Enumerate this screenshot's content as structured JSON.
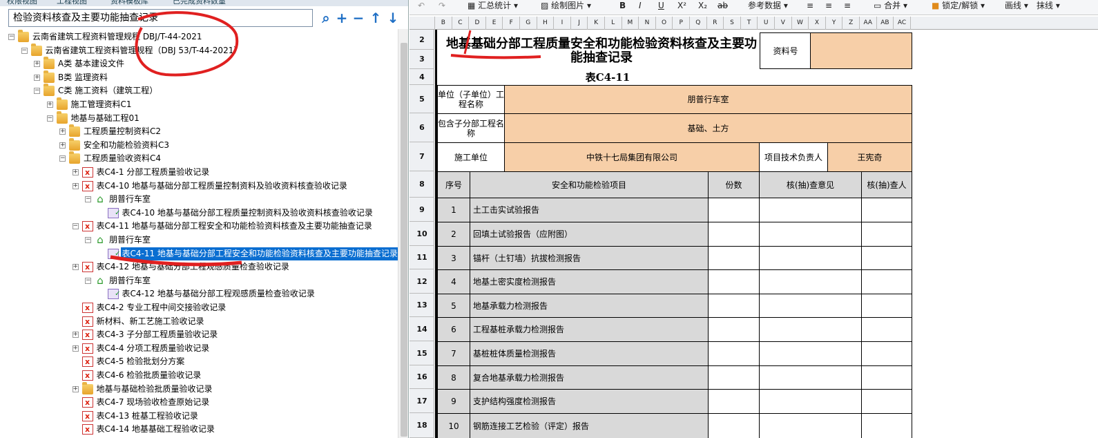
{
  "left_tabs": [
    "权限视图",
    "工程视图",
    "资料模板库",
    "已完成资料数量"
  ],
  "search": {
    "value": "检验资料核查及主要功能抽查记录"
  },
  "toolbar_icons": [
    "search-icon",
    "plus-icon",
    "minus-icon",
    "arrow-up-icon",
    "arrow-down-icon"
  ],
  "tree": [
    {
      "t": "云南省建筑工程资料管理规程 DBJ/T-44-2021",
      "lvl": 0,
      "exp": "-",
      "ico": "folder"
    },
    {
      "t": "云南省建筑工程资料管理规程（DBJ 53/T-44-2021）",
      "lvl": 1,
      "exp": "-",
      "ico": "folder"
    },
    {
      "t": "A类 基本建设文件",
      "lvl": 2,
      "exp": "+",
      "ico": "folder"
    },
    {
      "t": "B类 监理资料",
      "lvl": 2,
      "exp": "+",
      "ico": "folder"
    },
    {
      "t": "C类 施工资料（建筑工程）",
      "lvl": 2,
      "exp": "-",
      "ico": "folder"
    },
    {
      "t": "施工管理资料C1",
      "lvl": 3,
      "exp": "+",
      "ico": "folder"
    },
    {
      "t": "地基与基础工程01",
      "lvl": 3,
      "exp": "-",
      "ico": "folder"
    },
    {
      "t": "工程质量控制资料C2",
      "lvl": 4,
      "exp": "+",
      "ico": "folder"
    },
    {
      "t": "安全和功能检验资料C3",
      "lvl": 4,
      "exp": "+",
      "ico": "folder"
    },
    {
      "t": "工程质量验收资料C4",
      "lvl": 4,
      "exp": "-",
      "ico": "folder"
    },
    {
      "t": "表C4-1 分部工程质量验收记录",
      "lvl": 5,
      "exp": "+",
      "ico": "docx"
    },
    {
      "t": "表C4-10 地基与基础分部工程质量控制资料及验收资料核查验收记录",
      "lvl": 5,
      "exp": "+",
      "ico": "docx"
    },
    {
      "t": "朋普行车室",
      "lvl": 6,
      "exp": "-",
      "ico": "home"
    },
    {
      "t": "表C4-10 地基与基础分部工程质量控制资料及验收资料核查验收记录",
      "lvl": 7,
      "exp": "",
      "ico": "doc2"
    },
    {
      "t": "表C4-11 地基与基础分部工程安全和功能检验资料核查及主要功能抽查记录",
      "lvl": 5,
      "exp": "-",
      "ico": "docx"
    },
    {
      "t": "朋普行车室",
      "lvl": 6,
      "exp": "-",
      "ico": "home"
    },
    {
      "t": "表C4-11 地基与基础分部工程安全和功能检验资料核查及主要功能抽查记录",
      "lvl": 7,
      "exp": "",
      "ico": "doc2",
      "sel": true
    },
    {
      "t": "表C4-12 地基与基础分部工程观感质量检查验收记录",
      "lvl": 5,
      "exp": "+",
      "ico": "docx"
    },
    {
      "t": "朋普行车室",
      "lvl": 6,
      "exp": "-",
      "ico": "home"
    },
    {
      "t": "表C4-12 地基与基础分部工程观感质量检查验收记录",
      "lvl": 7,
      "exp": "",
      "ico": "doc2"
    },
    {
      "t": "表C4-2 专业工程中间交接验收记录",
      "lvl": 5,
      "exp": "",
      "ico": "docx"
    },
    {
      "t": "新材料、新工艺施工验收记录",
      "lvl": 5,
      "exp": "",
      "ico": "docx"
    },
    {
      "t": "表C4-3 子分部工程质量验收记录",
      "lvl": 5,
      "exp": "+",
      "ico": "docx"
    },
    {
      "t": "表C4-4 分项工程质量验收记录",
      "lvl": 5,
      "exp": "+",
      "ico": "docx"
    },
    {
      "t": "表C4-5 检验批划分方案",
      "lvl": 5,
      "exp": "",
      "ico": "docx"
    },
    {
      "t": "表C4-6 检验批质量验收记录",
      "lvl": 5,
      "exp": "",
      "ico": "docx"
    },
    {
      "t": "地基与基础检验批质量验收记录",
      "lvl": 5,
      "exp": "+",
      "ico": "folder"
    },
    {
      "t": "表C4-7 现场验收检查原始记录",
      "lvl": 5,
      "exp": "",
      "ico": "docx"
    },
    {
      "t": "表C4-13 桩基工程验收记录",
      "lvl": 5,
      "exp": "",
      "ico": "docx"
    },
    {
      "t": "表C4-14 地基基础工程验收记录",
      "lvl": 5,
      "exp": "",
      "ico": "docx"
    }
  ],
  "toolbar": {
    "total": "汇总统计",
    "draw": "绘制图片",
    "ref": "参考数据",
    "merge": "合并",
    "lock": "锁定/解锁",
    "line": "画线",
    "erase": "抹线"
  },
  "col_headers": [
    "B",
    "C",
    "D",
    "E",
    "F",
    "G",
    "H",
    "I",
    "J",
    "K",
    "L",
    "M",
    "N",
    "O",
    "P",
    "Q",
    "R",
    "S",
    "T",
    "U",
    "V",
    "W",
    "X",
    "Y",
    "Z",
    "AA",
    "AB",
    "AC"
  ],
  "row_headers": [
    "2",
    "3",
    "4",
    "5",
    "6",
    "7",
    "8",
    "9",
    "10",
    "11",
    "12",
    "13",
    "14",
    "15",
    "16",
    "17",
    "18"
  ],
  "form": {
    "title": "地基基础分部工程质量安全和功能检验资料核查及主要功能抽查记录",
    "doc_no_label": "资料号",
    "doc_no_value": "",
    "table_no": "表C4-11",
    "unit_label": "单位（子单位）工程名称",
    "unit_value": "朋普行车室",
    "sub_label": "包含子分部工程名称",
    "sub_value": "基础、土方",
    "builder_label": "施工单位",
    "builder_value": "中铁十七局集团有限公司",
    "tech_label": "项目技术负责人",
    "tech_value": "王宪奇",
    "headers": [
      "序号",
      "安全和功能检验项目",
      "份数",
      "核(抽)查意见",
      "核(抽)查人"
    ],
    "rows": [
      {
        "no": "1",
        "item": "土工击实试验报告"
      },
      {
        "no": "2",
        "item": "回填土试验报告（应附图）"
      },
      {
        "no": "3",
        "item": "锚杆（土钉墙）抗拔检测报告"
      },
      {
        "no": "4",
        "item": "地基土密实度检测报告"
      },
      {
        "no": "5",
        "item": "地基承载力检测报告"
      },
      {
        "no": "6",
        "item": "工程基桩承载力检测报告"
      },
      {
        "no": "7",
        "item": "基桩桩体质量检测报告"
      },
      {
        "no": "8",
        "item": "复合地基承载力检测报告"
      },
      {
        "no": "9",
        "item": "支护结构强度检测报告"
      },
      {
        "no": "10",
        "item": "钢筋连接工艺检验（评定）报告"
      }
    ]
  }
}
